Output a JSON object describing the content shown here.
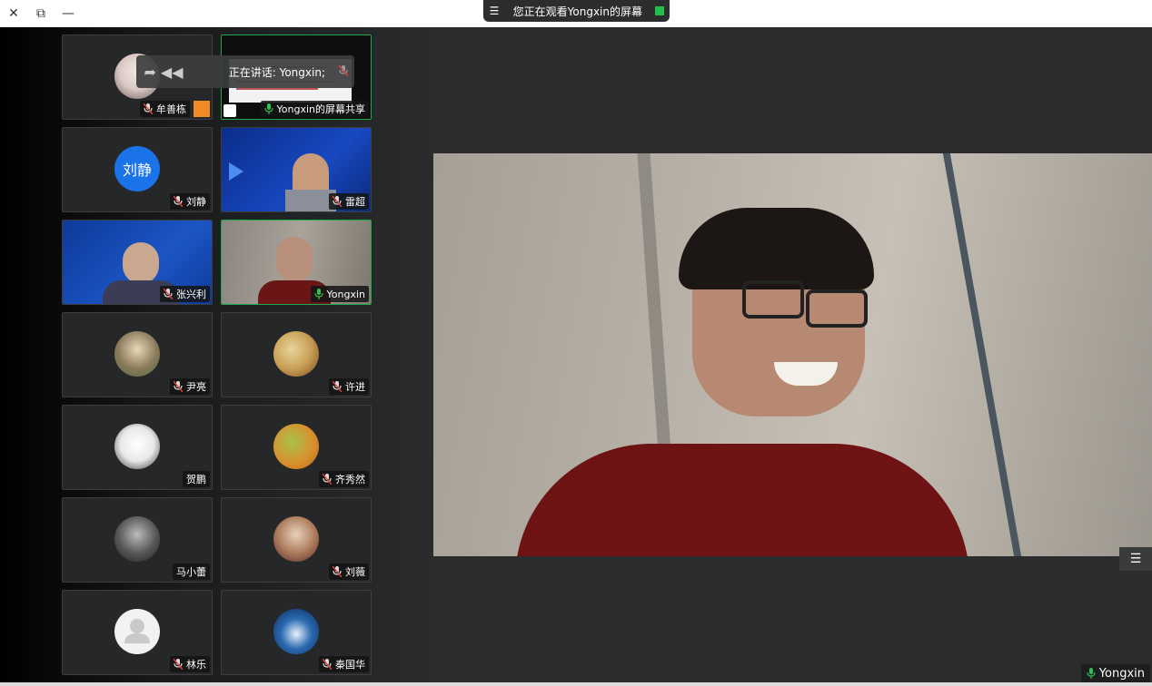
{
  "window": {
    "close_glyph": "✕",
    "restore_glyph": "⧉",
    "minimize_glyph": "—"
  },
  "banner": {
    "text": "您正在观看Yongxin的屏幕",
    "menu_glyph": "☰"
  },
  "speaking": {
    "text": "正在讲话: Yongxin;",
    "arrow_glyph": "➦ ◀◀"
  },
  "participants": [
    {
      "name": "Yongxin的屏幕共享",
      "muted": false,
      "active": true,
      "kind": "screen"
    },
    {
      "name": "牟善栋",
      "muted": true,
      "active": false,
      "kind": "avatar",
      "color": "#d9c9c4"
    },
    {
      "name": "雷超",
      "muted": true,
      "active": false,
      "kind": "video-blue"
    },
    {
      "name": "刘静",
      "muted": true,
      "active": false,
      "kind": "initials",
      "initials": "刘静",
      "color": "#1a73e8"
    },
    {
      "name": "Yongxin",
      "muted": false,
      "active": true,
      "kind": "video-room"
    },
    {
      "name": "张兴利",
      "muted": true,
      "active": false,
      "kind": "video-blue2"
    },
    {
      "name": "许进",
      "muted": true,
      "active": false,
      "kind": "avatar",
      "color": "#c9a057"
    },
    {
      "name": "尹亮",
      "muted": true,
      "active": false,
      "kind": "avatar",
      "color": "#8a7a5a"
    },
    {
      "name": "齐秀然",
      "muted": true,
      "active": false,
      "kind": "avatar",
      "color": "#d9912e"
    },
    {
      "name": "贺鹏",
      "muted": false,
      "active": false,
      "kind": "avatar",
      "color": "#e8e8e8"
    },
    {
      "name": "刘薇",
      "muted": true,
      "active": false,
      "kind": "avatar",
      "color": "#b08060"
    },
    {
      "name": "马小蕾",
      "muted": false,
      "active": false,
      "kind": "avatar",
      "color": "#555555"
    },
    {
      "name": "秦国华",
      "muted": true,
      "active": false,
      "kind": "avatar",
      "color": "#2a6ab0"
    },
    {
      "name": "林乐",
      "muted": true,
      "active": false,
      "kind": "default",
      "color": "#e8e8e8"
    }
  ],
  "main": {
    "name": "Yongxin",
    "menu_glyph": "☰"
  },
  "colors": {
    "accent_green": "#1ba94c",
    "muted_red": "#e2443b"
  }
}
